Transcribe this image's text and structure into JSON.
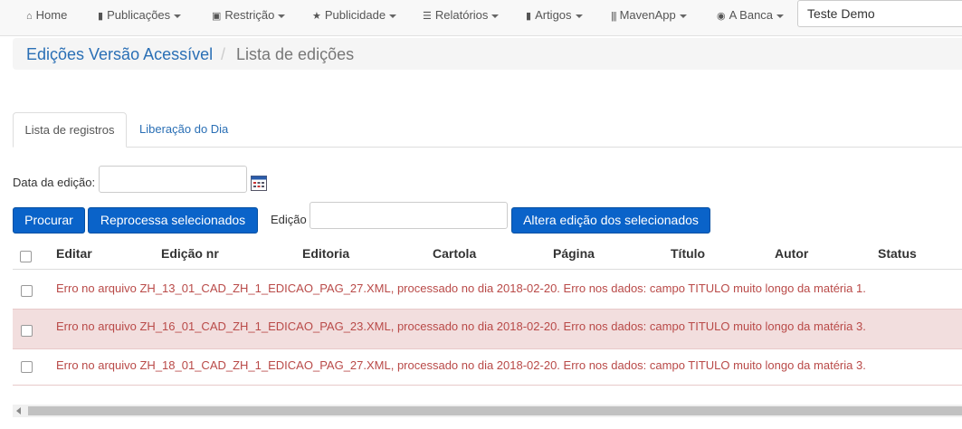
{
  "navbar": {
    "items": [
      {
        "label": "Home",
        "icon": "home-icon",
        "glyph": "⌂",
        "dropdown": false
      },
      {
        "label": "Publicações",
        "icon": "file-icon",
        "glyph": "▮",
        "dropdown": true
      },
      {
        "label": "Restrição",
        "icon": "lock-icon",
        "glyph": "🔒",
        "dropdown": true
      },
      {
        "label": "Publicidade",
        "icon": "star-icon",
        "glyph": "★",
        "dropdown": true
      },
      {
        "label": "Relatórios",
        "icon": "list-icon",
        "glyph": "☰",
        "dropdown": true
      },
      {
        "label": "Artigos",
        "icon": "bookmark-icon",
        "glyph": "▮",
        "dropdown": true
      },
      {
        "label": "MavenApp",
        "icon": "barcode-icon",
        "glyph": "|||",
        "dropdown": true
      },
      {
        "label": "A Banca",
        "icon": "globe-icon",
        "glyph": "◉",
        "dropdown": true
      }
    ],
    "search_value": "Teste Demo"
  },
  "breadcrumb": {
    "link": "Edições Versão Acessível",
    "separator": "/",
    "active": "Lista de edições"
  },
  "tabs": [
    {
      "label": "Lista de registros",
      "active": true
    },
    {
      "label": "Liberação do Dia",
      "active": false
    }
  ],
  "form": {
    "date_label": "Data da edição:",
    "date_value": "",
    "edition_label": "Edição",
    "edition_value": "",
    "buttons": {
      "search": "Procurar",
      "reprocess": "Reprocessa selecionados",
      "change_edition": "Altera edição dos selecionados"
    }
  },
  "table": {
    "headers": [
      "Editar",
      "Edição nr",
      "Editoria",
      "Cartola",
      "Página",
      "Título",
      "Autor",
      "Status"
    ],
    "rows": [
      {
        "message": "Erro no arquivo ZH_13_01_CAD_ZH_1_EDICAO_PAG_27.XML, processado no dia 2018-02-20. Erro nos dados: campo TITULO muito longo da matéria 1.",
        "highlighted": false
      },
      {
        "message": "Erro no arquivo ZH_16_01_CAD_ZH_1_EDICAO_PAG_23.XML, processado no dia 2018-02-20. Erro nos dados: campo TITULO muito longo da matéria 3.",
        "highlighted": true
      },
      {
        "message": "Erro no arquivo ZH_18_01_CAD_ZH_1_EDICAO_PAG_27.XML, processado no dia 2018-02-20. Erro nos dados: campo TITULO muito longo da matéria 3.",
        "highlighted": false
      }
    ]
  },
  "colors": {
    "link": "#2a6fb5",
    "button": "#0a63c9",
    "error_text": "#b94a48",
    "row_highlight": "#f2dede"
  }
}
